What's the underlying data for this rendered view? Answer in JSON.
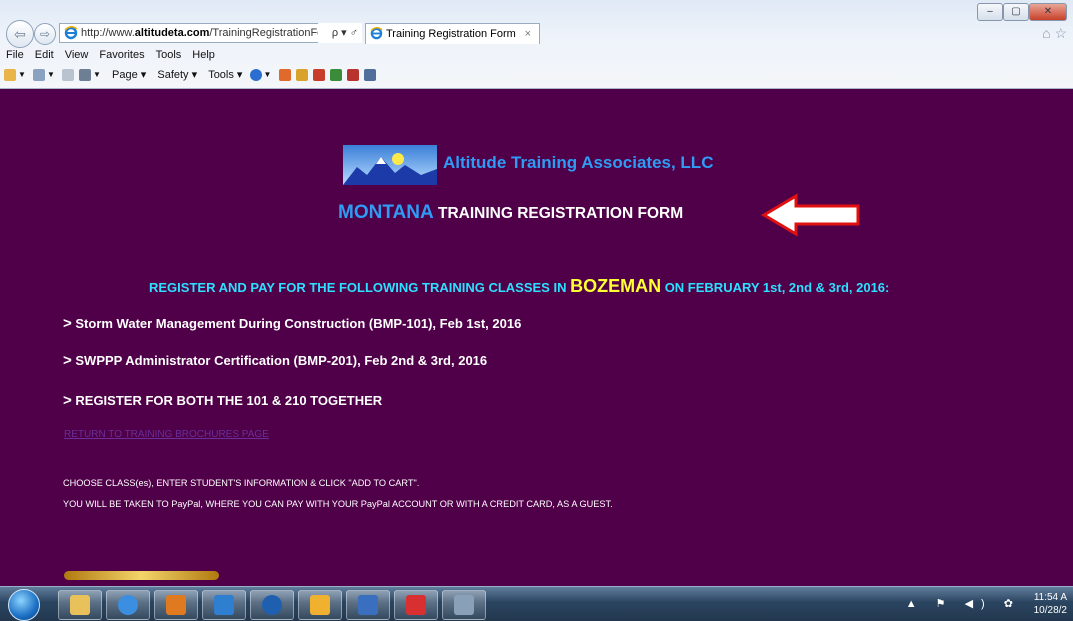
{
  "browser": {
    "url_prefix": "http://www.",
    "url_domain": "altitudeta.com",
    "url_path": "/TrainingRegistrationForm·",
    "addr_tools": "ρ ▾ ♂",
    "tab_title": "Training Registration Form",
    "tab_close": "×",
    "back": "⇦",
    "forward": "⇨",
    "window_buttons": [
      "–",
      "▢",
      "✕"
    ],
    "home_fav": "⌂ ☆",
    "menu": [
      "File",
      "Edit",
      "View",
      "Favorites",
      "Tools",
      "Help"
    ],
    "commands": [
      "Page ▾",
      "Safety ▾",
      "Tools ▾"
    ]
  },
  "page": {
    "company": "Altitude Training Associates, LLC",
    "form_state": "MONTANA",
    "form_title_rest": " TRAINING REGISTRATION FORM",
    "reg_prefix": "REGISTER AND PAY FOR THE FOLLOWING TRAINING CLASSES IN ",
    "reg_city": "BOZEMAN",
    "reg_suffix": " ON FEBRUARY 1st, 2nd & 3rd, 2016:",
    "courses": [
      {
        "marker": ">",
        "text": "Storm Water Management During Construction (BMP-101), Feb 1st, 2016"
      },
      {
        "marker": ">",
        "text": "SWPPP Administrator Certification (BMP-201), Feb 2nd & 3rd, 2016"
      },
      {
        "marker": ">",
        "text": "REGISTER FOR BOTH THE 101 & 210 TOGETHER"
      }
    ],
    "return_link": "RETURN TO TRAINING BROCHURES PAGE",
    "instructions": [
      "CHOOSE CLASS(es), ENTER STUDENT'S INFORMATION & CLICK \"ADD TO CART\".",
      "YOU WILL BE TAKEN TO PayPal, WHERE YOU CAN PAY WITH YOUR PayPal ACCOUNT OR WITH A CREDIT CARD, AS A GUEST."
    ]
  },
  "taskbar": {
    "tray_icons": "▲ ⚑ ◀) ✿",
    "time": "11:54 A",
    "date": "10/28/2"
  },
  "colors": {
    "page_bg": "#4f0048",
    "company_blue": "#2e9cf5",
    "reg_cyan": "#2ee0ff",
    "city_yellow": "#ffff33",
    "link_purple": "#6a2e96"
  }
}
